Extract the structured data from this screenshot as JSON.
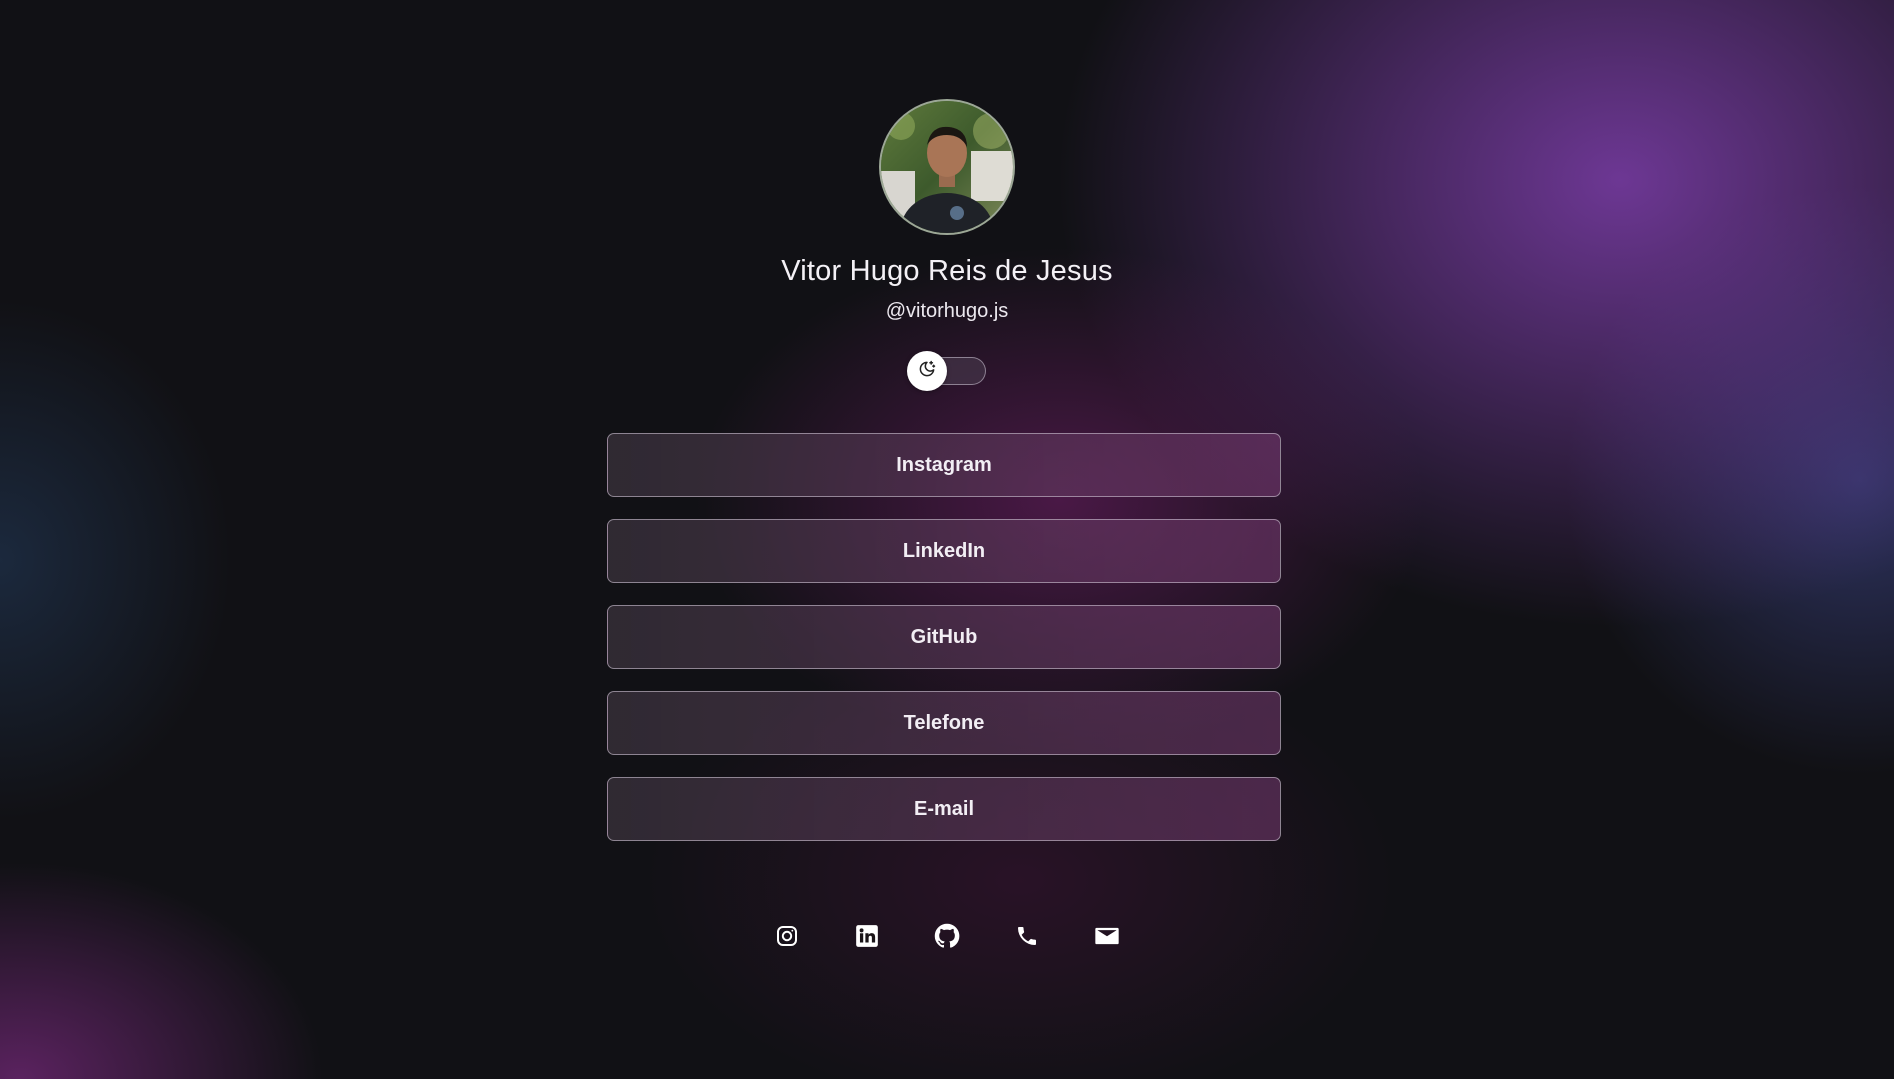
{
  "profile": {
    "name": "Vitor Hugo Reis de Jesus",
    "handle": "@vitorhugo.js",
    "avatar_icon": "profile-photo"
  },
  "theme_toggle": {
    "icon": "moon-sun-icon",
    "state": "dark"
  },
  "links": [
    {
      "label": "Instagram"
    },
    {
      "label": "LinkedIn"
    },
    {
      "label": "GitHub"
    },
    {
      "label": "Telefone"
    },
    {
      "label": "E-mail"
    }
  ],
  "socials": [
    {
      "icon": "instagram-icon"
    },
    {
      "icon": "linkedin-icon"
    },
    {
      "icon": "github-icon"
    },
    {
      "icon": "phone-icon"
    },
    {
      "icon": "mail-icon"
    }
  ],
  "colors": {
    "background": "#111115",
    "accent_purple": "#7d3eaa",
    "text": "#ffffff"
  }
}
